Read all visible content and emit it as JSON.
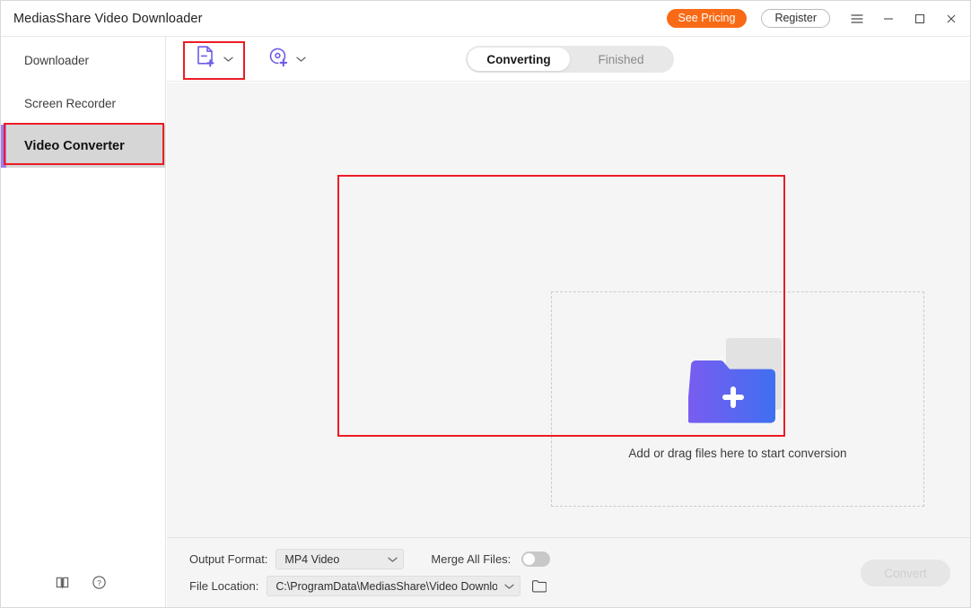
{
  "window": {
    "title": "MediasShare Video Downloader",
    "controls": {
      "pricing_label": "See Pricing",
      "register_label": "Register",
      "menu_icon": "hamburger-menu-icon",
      "minimize_icon": "minimize-icon",
      "maximize_icon": "maximize-icon",
      "close_icon": "close-icon"
    },
    "accent_orange": "#f96a16",
    "accent_purple": "#6c5ce7"
  },
  "sidebar": {
    "items": [
      {
        "label": "Downloader",
        "active": false
      },
      {
        "label": "Screen Recorder",
        "active": false
      },
      {
        "label": "Video Converter",
        "active": true
      }
    ],
    "bottom_icons": [
      {
        "name": "manual-book-icon"
      },
      {
        "name": "help-circle-icon"
      }
    ]
  },
  "toolbar": {
    "add_file_icon": "add-file-icon",
    "add_file_chevron": "chevron-down-icon",
    "add_disc_icon": "add-disc-icon",
    "add_disc_chevron": "chevron-down-icon",
    "tabs": [
      {
        "label": "Converting",
        "active": true
      },
      {
        "label": "Finished",
        "active": false
      }
    ]
  },
  "dropzone": {
    "message": "Add or drag files here to start conversion",
    "folder_icon": "add-folder-icon",
    "gradient_from": "#7a5cf0",
    "gradient_to": "#3f6ff0"
  },
  "bottombar": {
    "output_format_label": "Output Format:",
    "output_format_value": "MP4 Video",
    "merge_label": "Merge All Files:",
    "merge_enabled": false,
    "file_location_label": "File Location:",
    "file_location_value": "C:\\ProgramData\\MediasShare\\Video Downloa",
    "browse_icon": "folder-icon",
    "convert_label": "Convert",
    "convert_enabled": false
  },
  "annotations": {
    "highlight_color": "#ec1c24",
    "regions": [
      "sidebar-video-converter",
      "toolbar-add-file",
      "dropzone-area"
    ]
  }
}
